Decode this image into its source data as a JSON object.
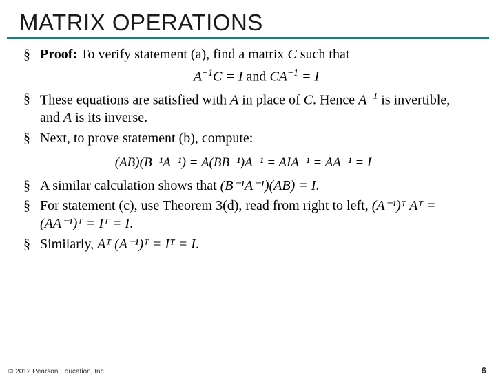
{
  "title": "MATRIX OPERATIONS",
  "bullets": {
    "b1_label": "Proof:",
    "b1_text": " To verify statement (a), find a matrix ",
    "b1_var": "C",
    "b1_tail": " such that",
    "eq1_left": "A",
    "eq1_sup1": "−1",
    "eq1_mid": "C = I",
    "eq1_and": "  and  ",
    "eq1_right1": "CA",
    "eq1_sup2": "−1",
    "eq1_right2": " = I",
    "b2_a": "These equations are satisfied with ",
    "b2_A": "A",
    "b2_b": " in place of ",
    "b2_C": "C",
    "b2_c": ". Hence ",
    "b2_Ainv1": "A",
    "b2_sup": "−1",
    "b2_d": " is invertible, and ",
    "b2_A2": "A",
    "b2_e": " is its inverse.",
    "b3": "Next, to prove statement (b), compute:",
    "eq2": "(AB)(B⁻¹A⁻¹) = A(BB⁻¹)A⁻¹ = AIA⁻¹ = AA⁻¹ = I",
    "b4_a": "A similar calculation shows that ",
    "b4_eq": "(B⁻¹A⁻¹)(AB) = I",
    "b4_b": ".",
    "b5": "For statement (c), use Theorem 3(d), read from right to left,   ",
    "b5_eq": "(A⁻¹)ᵀ Aᵀ = (AA⁻¹)ᵀ = Iᵀ = I",
    "b5_b": ".",
    "b6_a": "Similarly,   ",
    "b6_eq": "Aᵀ (A⁻¹)ᵀ = Iᵀ = I",
    "b6_b": "."
  },
  "footer": {
    "copyright": "© 2012 Pearson Education, Inc.",
    "pageno": "6"
  }
}
